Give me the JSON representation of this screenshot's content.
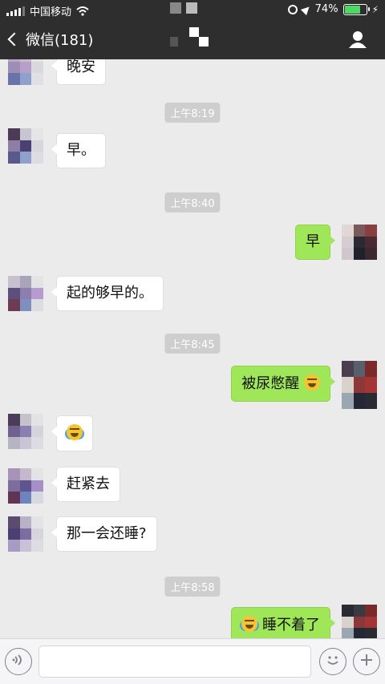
{
  "status": {
    "carrier": "中国移动",
    "battery_text": "74%",
    "battery_level": 0.74
  },
  "nav": {
    "back_label": "微信(181)"
  },
  "messages": [
    {
      "type": "in",
      "text": "晚安"
    },
    {
      "type": "time",
      "text": "上午8:19"
    },
    {
      "type": "in",
      "text": "早。"
    },
    {
      "type": "time",
      "text": "上午8:40"
    },
    {
      "type": "out",
      "text": "早"
    },
    {
      "type": "in",
      "text": "起的够早的。"
    },
    {
      "type": "time",
      "text": "上午8:45"
    },
    {
      "type": "out",
      "text": "被尿憋醒",
      "emoji_after": "angry-face-icon"
    },
    {
      "type": "in",
      "text": "",
      "emoji_only": "laughing-tears-icon"
    },
    {
      "type": "in",
      "text": "赶紧去"
    },
    {
      "type": "in",
      "text": "那一会还睡?"
    },
    {
      "type": "time",
      "text": "上午8:58"
    },
    {
      "type": "out",
      "text": "睡不着了",
      "emoji_before": "laughing-tears-icon"
    }
  ],
  "colors": {
    "header_bg": "#2e2e2f",
    "chat_bg": "#ebebeb",
    "outgoing_bubble": "#9fe658",
    "incoming_bubble": "#ffffff",
    "timestamp_bg": "#cecece",
    "battery_fill": "#4cd964"
  },
  "icons": {
    "back": "chevron-left-icon",
    "profile": "person-icon",
    "voice": "voice-icon",
    "emoji": "smiley-icon",
    "add": "plus-icon"
  }
}
